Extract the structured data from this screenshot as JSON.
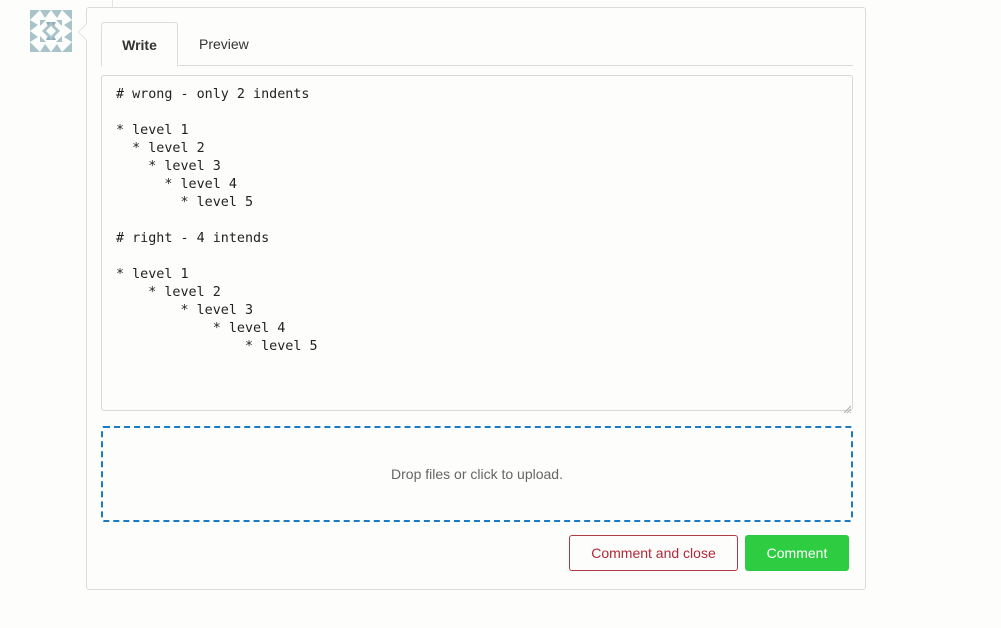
{
  "tabs": {
    "write_label": "Write",
    "preview_label": "Preview",
    "active": "Write"
  },
  "editor": {
    "value": "# wrong - only 2 indents\n\n* level 1\n  * level 2\n    * level 3\n      * level 4\n        * level 5\n\n# right - 4 intends\n\n* level 1\n    * level 2\n        * level 3\n            * level 4\n                * level 5"
  },
  "dropzone": {
    "label": "Drop files or click to upload."
  },
  "actions": {
    "comment_and_close_label": "Comment and close",
    "comment_label": "Comment"
  },
  "colors": {
    "accent_blue": "#1a7bc4",
    "close_red": "#b0283a",
    "comment_green": "#2ecc40"
  },
  "icons": {
    "avatar": "identicon-avatar",
    "resize": "resize-grip-icon"
  }
}
